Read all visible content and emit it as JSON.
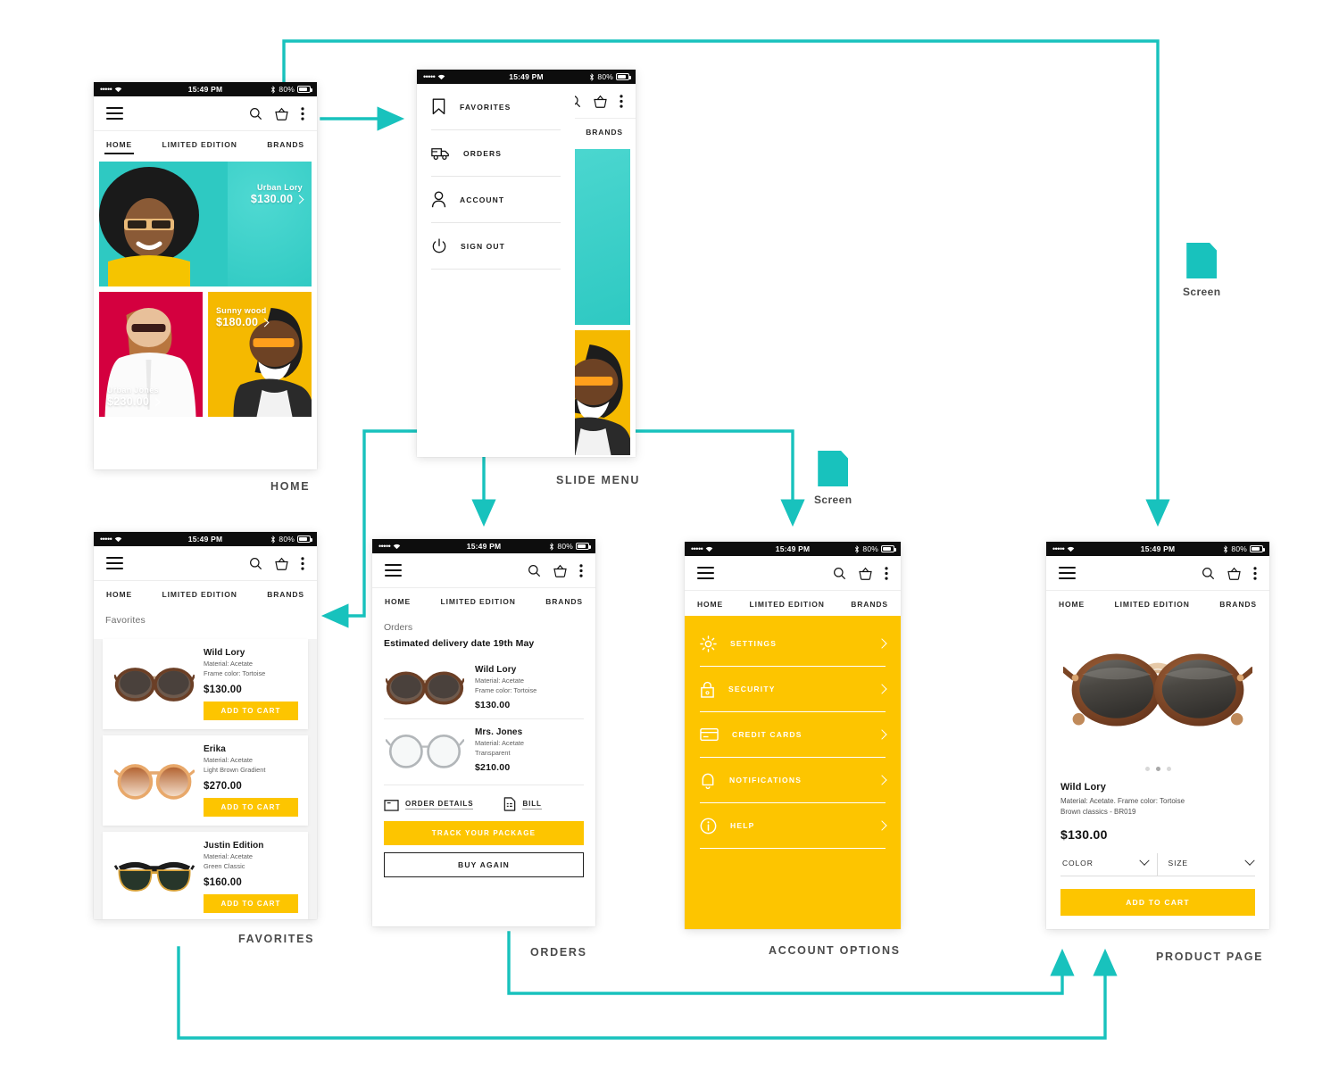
{
  "theme": {
    "teal": "#18c2bd",
    "yellow": "#fdc500",
    "dark": "#111111"
  },
  "statusbar": {
    "dots": "•••••",
    "time": "15:49 PM",
    "battery": "80%"
  },
  "appbar": {
    "menu_icon": "hamburger-icon",
    "search_icon": "search-icon",
    "cart_icon": "basket-icon",
    "more_icon": "overflow-menu-icon"
  },
  "tabs": {
    "home": "HOME",
    "limited": "LIMITED EDITION",
    "brands": "BRANDS"
  },
  "screens": {
    "home": {
      "caption": "HOME",
      "tiles": [
        {
          "name": "Urban Lory",
          "price": "$130.00"
        },
        {
          "name": "Urban Jones",
          "price": "$230.00"
        },
        {
          "name": "Sunny wood",
          "price": "$180.00"
        }
      ]
    },
    "slide_menu": {
      "caption": "SLIDE MENU",
      "items": [
        {
          "label": "FAVORITES",
          "icon": "bookmark-icon"
        },
        {
          "label": "ORDERS",
          "icon": "truck-icon"
        },
        {
          "label": "ACCOUNT",
          "icon": "person-icon"
        },
        {
          "label": "SIGN OUT",
          "icon": "power-icon"
        }
      ]
    },
    "favorites": {
      "caption": "FAVORITES",
      "section_title": "Favorites",
      "add_to_cart": "ADD TO CART",
      "items": [
        {
          "name": "Wild Lory",
          "meta1": "Material: Acetate",
          "meta2": "Frame color: Tortoise",
          "price": "$130.00"
        },
        {
          "name": "Erika",
          "meta1": "Material: Acetate",
          "meta2": "Light Brown Gradient",
          "price": "$270.00"
        },
        {
          "name": "Justin Edition",
          "meta1": "Material: Acetate",
          "meta2": "Green Classic",
          "price": "$160.00"
        }
      ]
    },
    "orders": {
      "caption": "ORDERS",
      "section_title": "Orders",
      "eta": "Estimated delivery date 19th May",
      "items": [
        {
          "name": "Wild Lory",
          "meta1": "Material: Acetate",
          "meta2": "Frame color: Tortoise",
          "price": "$130.00"
        },
        {
          "name": "Mrs. Jones",
          "meta1": "Material: Acetate",
          "meta2": "Transparent",
          "price": "$210.00"
        }
      ],
      "order_details": "ORDER DETAILS",
      "bill": "BILL",
      "track": "TRACK YOUR PACKAGE",
      "buy_again": "BUY AGAIN"
    },
    "account_options": {
      "caption": "ACCOUNT OPTIONS",
      "items": [
        {
          "label": "SETTINGS",
          "icon": "gear-icon"
        },
        {
          "label": "SECURITY",
          "icon": "lock-icon"
        },
        {
          "label": "CREDIT CARDS",
          "icon": "credit-card-icon"
        },
        {
          "label": "NOTIFICATIONS",
          "icon": "bell-icon"
        },
        {
          "label": "HELP",
          "icon": "info-icon"
        }
      ]
    },
    "product_page": {
      "caption": "PRODUCT PAGE",
      "name": "Wild Lory",
      "desc_line1": "Material: Acetate. Frame color: Tortoise",
      "desc_line2": "Brown classics - BR019",
      "price": "$130.00",
      "color_label": "COLOR",
      "size_label": "SIZE",
      "add_to_cart": "ADD TO CART"
    }
  },
  "legend": [
    {
      "label": "Screen",
      "icon": "page-icon"
    },
    {
      "label": "Screen",
      "icon": "page-icon"
    }
  ]
}
